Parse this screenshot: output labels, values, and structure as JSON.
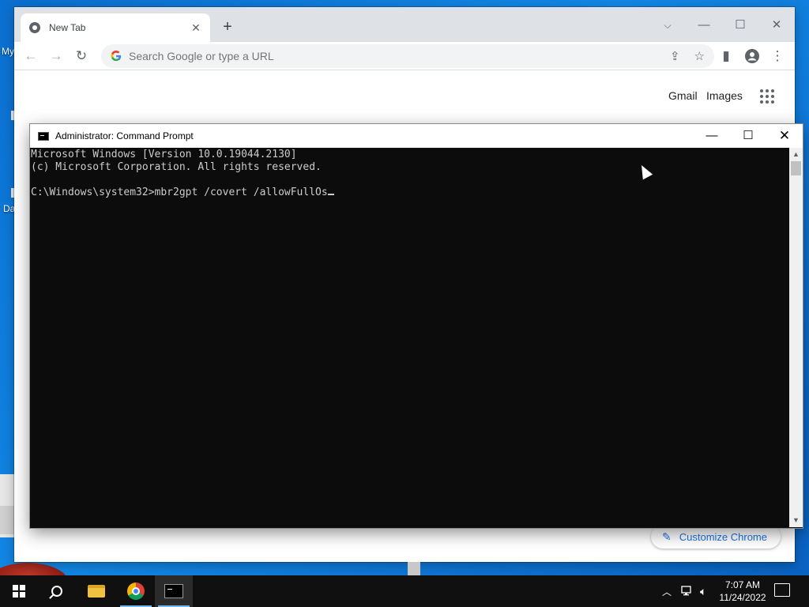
{
  "desktop": {
    "label_my": "My",
    "label_da": "Da"
  },
  "chrome": {
    "tab_title": "New Tab",
    "omnibox_placeholder": "Search Google or type a URL",
    "links": {
      "gmail": "Gmail",
      "images": "Images"
    },
    "customize_label": "Customize Chrome"
  },
  "cmd": {
    "title": "Administrator: Command Prompt",
    "lines": [
      "Microsoft Windows [Version 10.0.19044.2130]",
      "(c) Microsoft Corporation. All rights reserved.",
      "",
      "C:\\Windows\\system32>mbr2gpt /covert /allowFullOs"
    ]
  },
  "taskbar": {
    "time": "7:07 AM",
    "date": "11/24/2022"
  },
  "icons": {
    "chrome_window": [
      "chrome-favicon-icon",
      "close-icon",
      "plus-icon",
      "chevron-down-icon",
      "minimize-icon",
      "maximize-icon",
      "back-icon",
      "forward-icon",
      "reload-icon",
      "google-g-icon",
      "share-icon",
      "star-icon",
      "side-panel-icon",
      "profile-icon",
      "more-icon",
      "apps-icon",
      "pencil-icon"
    ],
    "taskbar": [
      "windows-start-icon",
      "search-icon",
      "file-explorer-icon",
      "chrome-icon",
      "command-prompt-icon",
      "chevron-up-icon",
      "network-icon",
      "volume-icon",
      "notification-icon"
    ]
  },
  "colors": {
    "desktop_blue": "#0b6fd0",
    "console_bg": "#0c0c0c",
    "console_text": "#cccccc",
    "chrome_accent": "#1a73e8",
    "taskbar_bg": "#101010"
  }
}
